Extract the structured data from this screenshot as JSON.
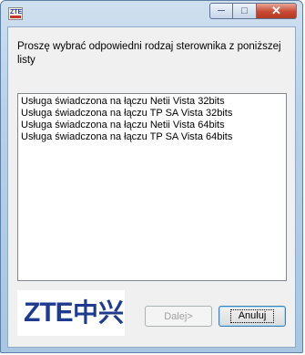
{
  "window": {
    "icon": "zte-app-icon",
    "icon_text": "ZTE"
  },
  "controls": {
    "minimize": "minimize-icon",
    "maximize": "maximize-icon",
    "close": "close-icon"
  },
  "prompt": "Proszę wybrać odpowiedni rodzaj sterownika z poniższej listy",
  "list_items": [
    "Usługa świadczona na łączu Netii Vista 32bits",
    "Usługa świadczona na łączu TP SA Vista 32bits",
    "Usługa świadczona na łączu Netii Vista 64bits",
    "Usługa świadczona na łączu TP SA Vista 64bits"
  ],
  "logo": {
    "latin": "ZTE",
    "chinese": "中兴"
  },
  "buttons": {
    "next": "Dalej>",
    "cancel": "Anuluj"
  },
  "colors": {
    "brand": "#1e3b8f",
    "close": "#c74a32"
  }
}
